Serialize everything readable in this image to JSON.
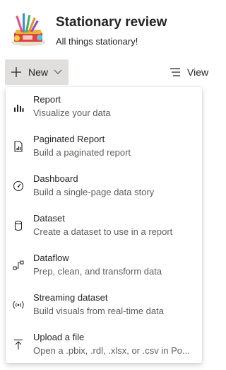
{
  "workspace": {
    "title": "Stationary review",
    "subtitle": "All things stationary!"
  },
  "toolbar": {
    "new_label": "New",
    "view_label": "View"
  },
  "menu": {
    "items": [
      {
        "title": "Report",
        "description": "Visualize your data",
        "icon": "bar-chart-icon"
      },
      {
        "title": "Paginated Report",
        "description": "Build a paginated report",
        "icon": "paginated-report-icon"
      },
      {
        "title": "Dashboard",
        "description": "Build a single-page data story",
        "icon": "gauge-icon"
      },
      {
        "title": "Dataset",
        "description": "Create a dataset to use in a report",
        "icon": "database-icon"
      },
      {
        "title": "Dataflow",
        "description": "Prep, clean, and transform data",
        "icon": "dataflow-icon"
      },
      {
        "title": "Streaming dataset",
        "description": "Build visuals from real-time data",
        "icon": "broadcast-icon"
      },
      {
        "title": "Upload a file",
        "description": "Open a .pbix, .rdl, .xlsx, or .csv in Po...",
        "icon": "upload-icon"
      }
    ]
  },
  "colors": {
    "button_bg": "#e1dfdd",
    "text_primary": "#252423",
    "text_secondary": "#605e5c"
  }
}
